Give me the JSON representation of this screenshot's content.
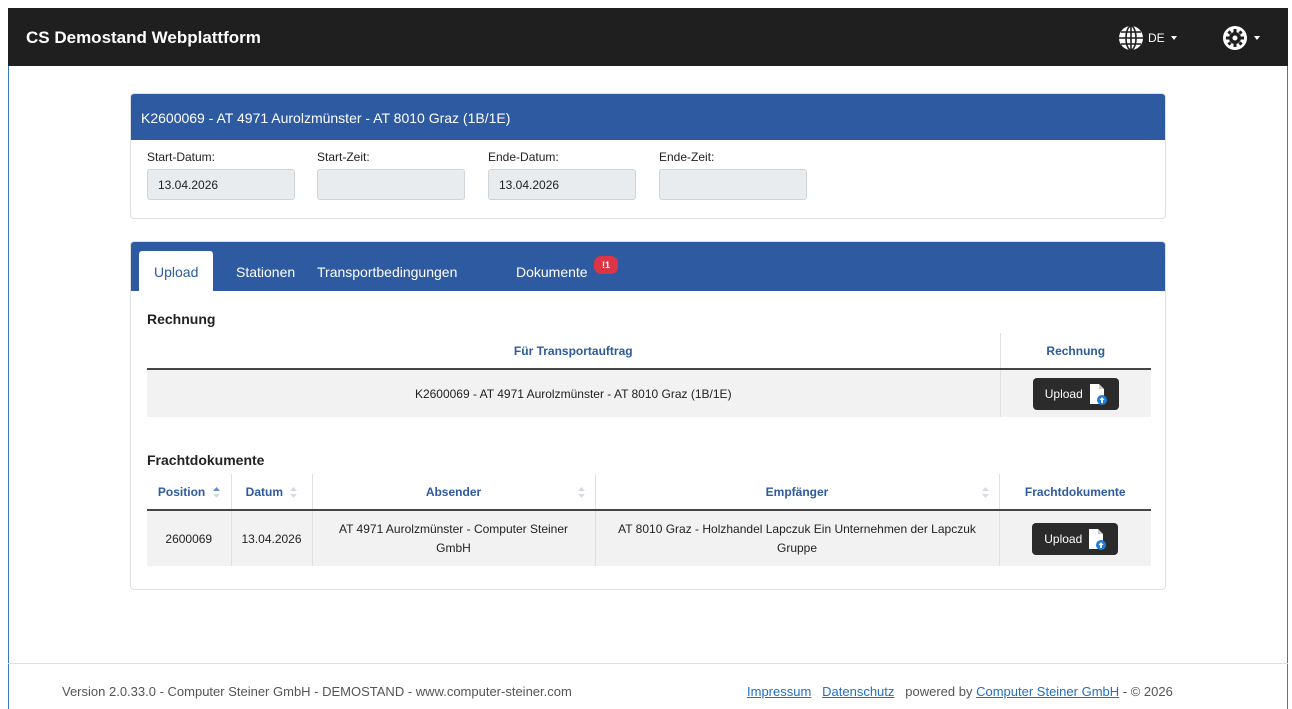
{
  "app": {
    "title": "CS Demostand Webplattform",
    "language": "DE"
  },
  "order": {
    "title": "K2600069 - AT 4971 Aurolzmünster - AT 8010 Graz (1B/1E)",
    "fields": [
      {
        "label": "Start-Datum:",
        "value": "13.04.2026"
      },
      {
        "label": "Start-Zeit:",
        "value": ""
      },
      {
        "label": "Ende-Datum:",
        "value": "13.04.2026"
      },
      {
        "label": "Ende-Zeit:",
        "value": ""
      }
    ]
  },
  "tabs": [
    {
      "label": "Upload",
      "active": true
    },
    {
      "label": "Stationen",
      "active": false
    },
    {
      "label": "Transportbedingungen",
      "active": false
    },
    {
      "label": "Dokumente",
      "active": false,
      "badge": "!1"
    }
  ],
  "rechnung": {
    "title": "Rechnung",
    "headers": [
      "Für Transportauftrag",
      "Rechnung"
    ],
    "row": {
      "auftrag": "K2600069 - AT 4971 Aurolzmünster - AT 8010 Graz (1B/1E)",
      "button": "Upload"
    }
  },
  "fracht": {
    "title": "Frachtdokumente",
    "headers": [
      "Position",
      "Datum",
      "Absender",
      "Empfänger",
      "Frachtdokumente"
    ],
    "rows": [
      {
        "position": "2600069",
        "datum": "13.04.2026",
        "absender": "AT 4971 Aurolzmünster - Computer Steiner GmbH",
        "empfaenger": "AT 8010 Graz - Holzhandel Lapczuk Ein Unternehmen der Lapczuk Gruppe",
        "button": "Upload"
      }
    ]
  },
  "footer": {
    "version": "Version 2.0.33.0 - Computer Steiner GmbH - DEMOSTAND - www.computer-steiner.com",
    "impressum": "Impressum",
    "datenschutz": "Datenschutz",
    "powered": "powered by",
    "company": "Computer Steiner GmbH",
    "copyright": "- © 2026"
  },
  "colors": {
    "navbar": "#1f1f1f",
    "header_blue": "#2d5aa0",
    "badge": "#dc3545",
    "link": "#1e6fc4"
  }
}
